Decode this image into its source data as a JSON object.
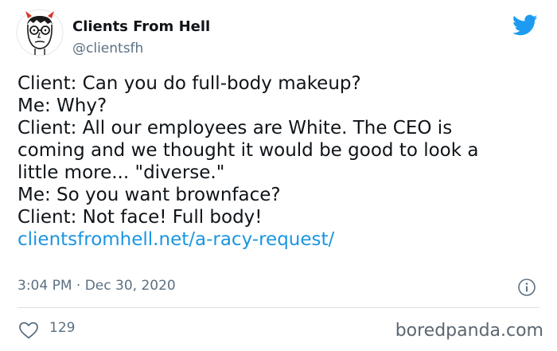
{
  "account": {
    "name": "Clients From Hell",
    "handle": "@clientsfh"
  },
  "tweet": {
    "lines": [
      "Client: Can you do full-body makeup?",
      "Me: Why?",
      "Client: All our employees are White. The CEO is",
      "coming and we thought it would be good to look a",
      "little more... \"diverse.\"",
      "Me: So you want brownface?",
      "Client: Not face! Full body!"
    ],
    "link": "clientsfromhell.net/a-racy-request/",
    "timestamp": "3:04 PM · Dec 30, 2020",
    "likes": "129"
  },
  "watermark": "boredpanda.com",
  "colors": {
    "link": "#1b95e0",
    "twitter_blue": "#1d9bf0",
    "muted": "#5b7083",
    "avatar_horns": "#d9342b"
  },
  "icons": {
    "avatar": "devil-man-avatar",
    "brand": "twitter-bird-icon",
    "info": "info-icon",
    "like": "heart-icon"
  }
}
